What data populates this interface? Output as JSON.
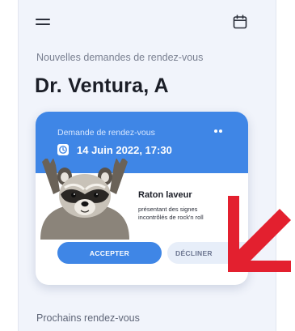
{
  "header": {
    "menu_icon": "hamburger-menu-icon",
    "calendar_icon": "calendar-icon"
  },
  "section": {
    "new_requests_label": "Nouvelles demandes de rendez-vous",
    "doctor_name": "Dr. Ventura, A"
  },
  "request_card": {
    "label": "Demande de rendez-vous",
    "date_time": "14 Juin 2022, 17:30",
    "patient_species": "Raton laveur",
    "description_line1": "présentant des signes",
    "description_line2": "incontrôlés de rock'n roll",
    "accept_label": "ACCEPTER",
    "decline_label": "DÉCLINER",
    "colors": {
      "accent": "#3f86e6",
      "decline_bg": "#e7eef9"
    }
  },
  "upcoming": {
    "label": "Prochains rendez-vous"
  },
  "overlay": {
    "arrow_icon": "swipe-arrow-icon",
    "arrow_color": "#e3202f"
  }
}
